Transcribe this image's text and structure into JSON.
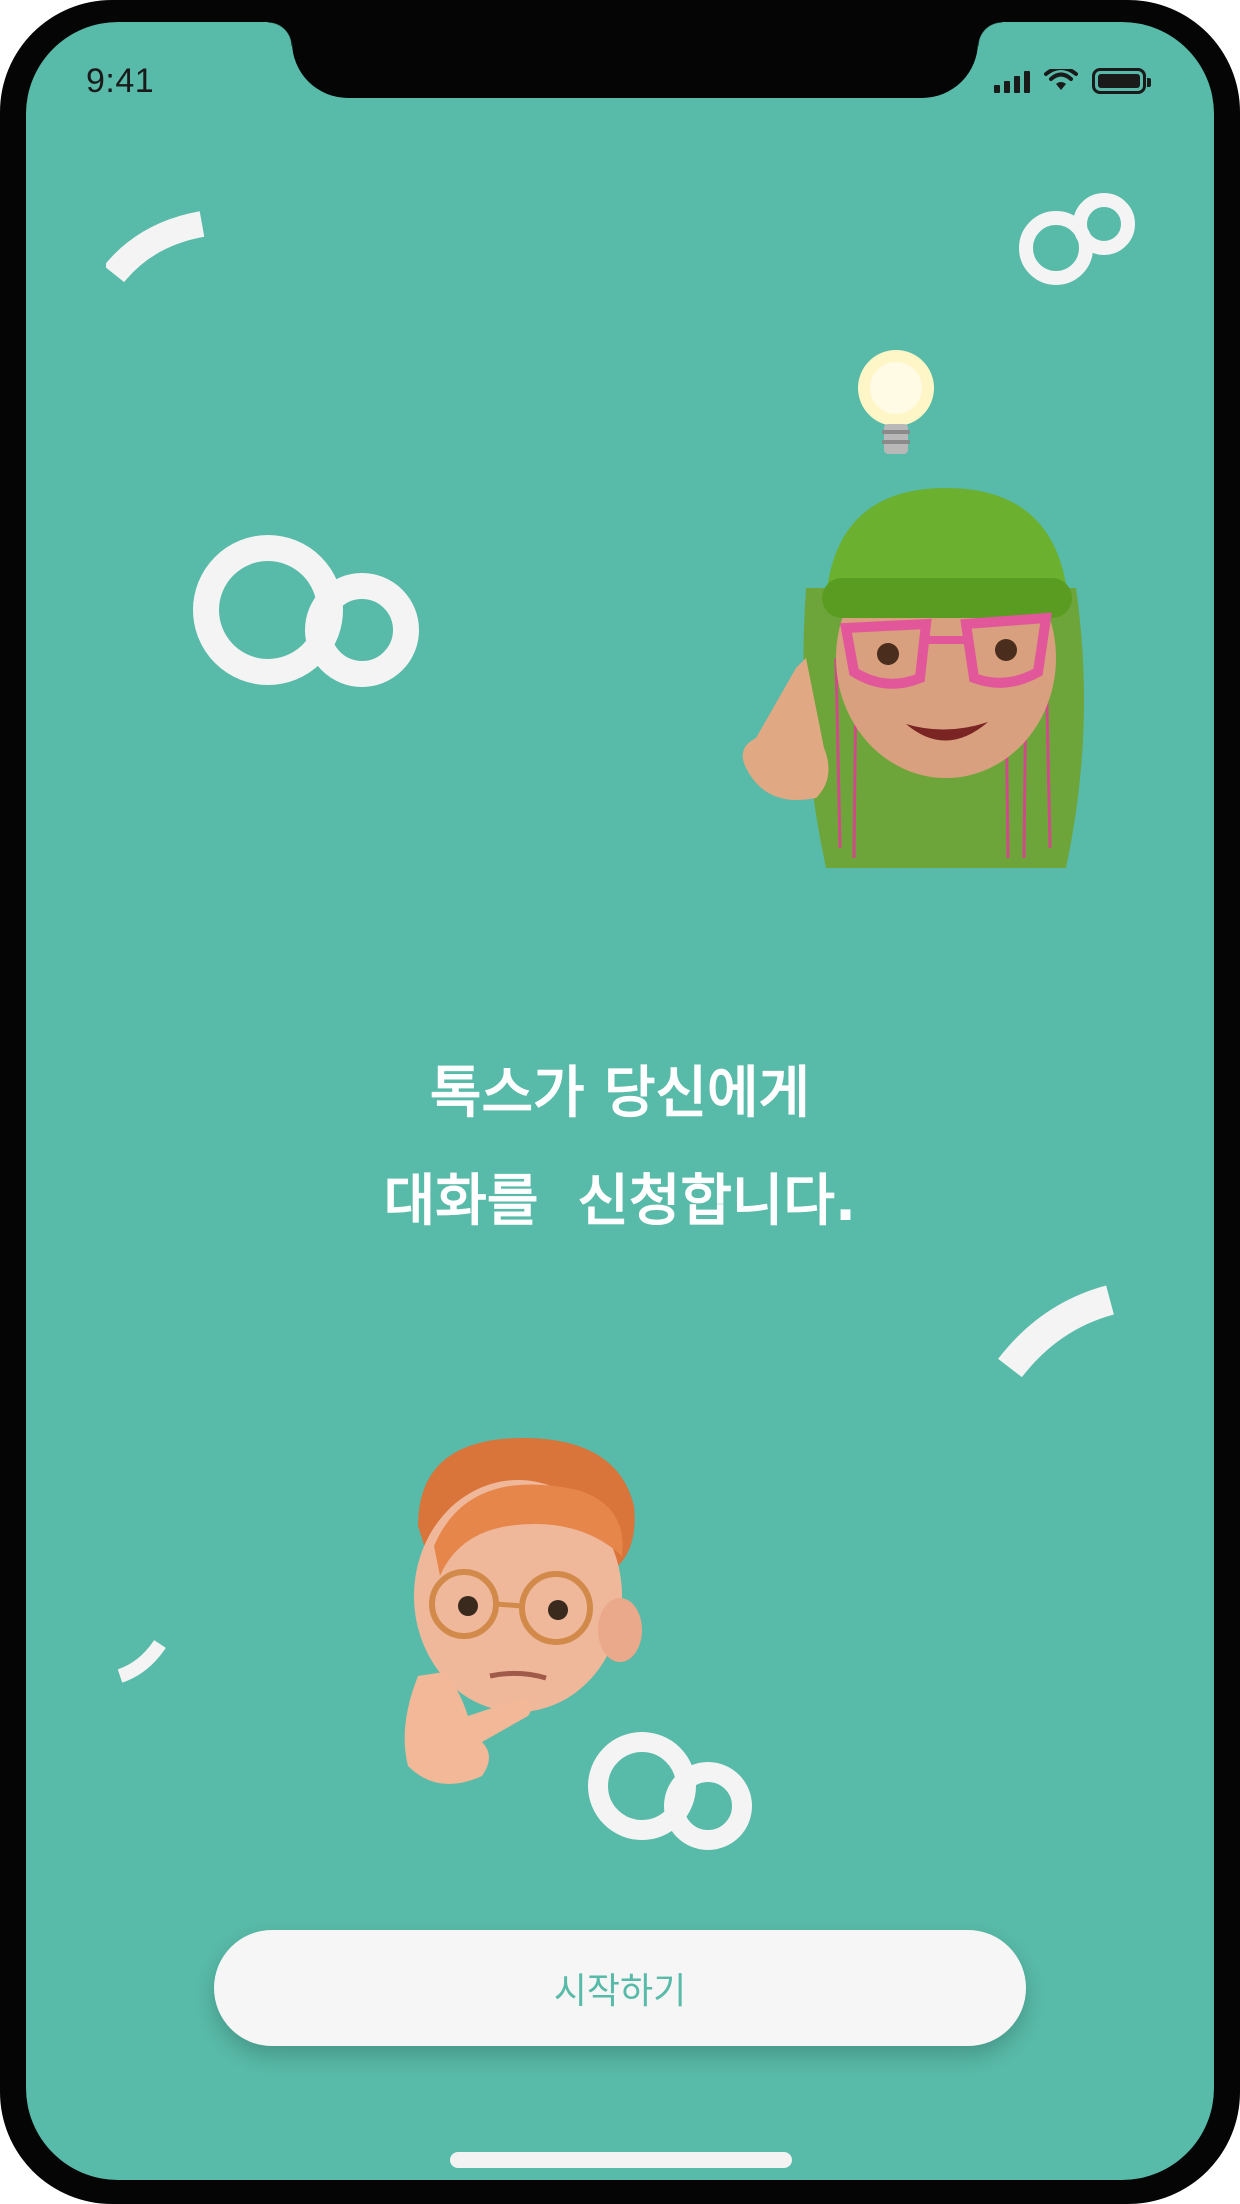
{
  "status_bar": {
    "time": "9:41",
    "signal_icon": "cellular-signal-icon",
    "wifi_icon": "wifi-icon",
    "battery_icon": "battery-icon"
  },
  "colors": {
    "background": "#58baa8",
    "decoration": "#f4f4f4",
    "button_bg": "#f6f6f6",
    "button_text": "#58baa8"
  },
  "illustrations": {
    "top": "memoji-girl-idea",
    "bottom": "memoji-boy-thinking"
  },
  "headline": "톡스가 당신에게\n대화를  신청합니다.",
  "start_button": {
    "label": "시작하기"
  }
}
